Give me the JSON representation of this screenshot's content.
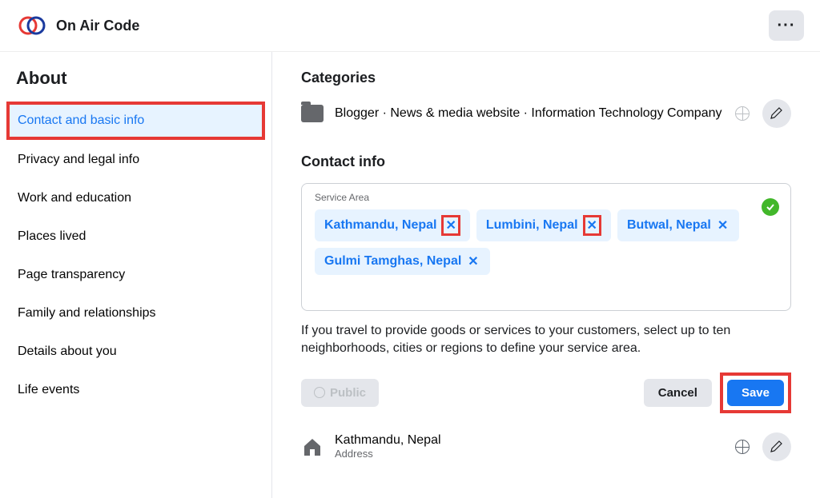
{
  "header": {
    "page_name": "On Air Code"
  },
  "sidebar": {
    "title": "About",
    "items": [
      {
        "label": "Contact and basic info",
        "active": true
      },
      {
        "label": "Privacy and legal info",
        "active": false
      },
      {
        "label": "Work and education",
        "active": false
      },
      {
        "label": "Places lived",
        "active": false
      },
      {
        "label": "Page transparency",
        "active": false
      },
      {
        "label": "Family and relationships",
        "active": false
      },
      {
        "label": "Details about you",
        "active": false
      },
      {
        "label": "Life events",
        "active": false
      }
    ]
  },
  "content": {
    "categories": {
      "title": "Categories",
      "text": "Blogger · News & media website · Information Technology Company"
    },
    "contact_info": {
      "title": "Contact info",
      "service_area": {
        "label": "Service Area",
        "chips": [
          {
            "label": "Kathmandu, Nepal",
            "highlighted": true
          },
          {
            "label": "Lumbini, Nepal",
            "highlighted": true
          },
          {
            "label": "Butwal, Nepal",
            "highlighted": false
          },
          {
            "label": "Gulmi Tamghas, Nepal",
            "highlighted": false
          }
        ],
        "help_text": "If you travel to provide goods or services to your customers, select up to ten neighborhoods, cities or regions to define your service area."
      },
      "public_label": "Public",
      "cancel_label": "Cancel",
      "save_label": "Save",
      "address": {
        "location": "Kathmandu, Nepal",
        "sublabel": "Address"
      }
    }
  }
}
